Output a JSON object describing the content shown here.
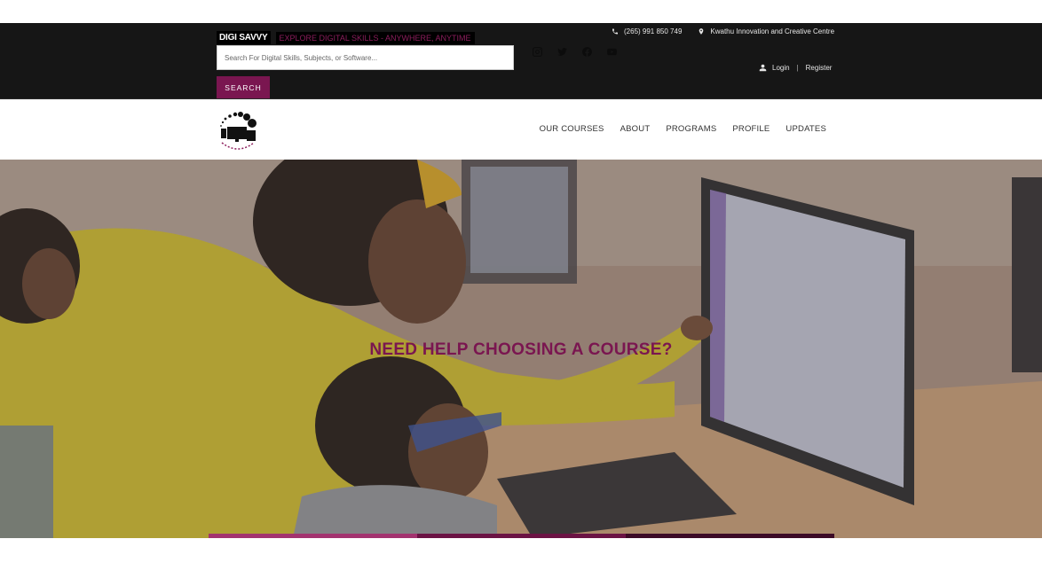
{
  "topbar": {
    "brand_name": "DIGI SAVVY",
    "tagline": "EXPLORE DIGITAL SKILLS - ANYWHERE, ANYTIME",
    "search_placeholder": "Search For Digital Skills, Subjects, or Software...",
    "search_button": "SEARCH",
    "phone": "(265) 991 850 749",
    "location": "Kwathu Innovation and Creative Centre",
    "login": "Login",
    "separator": "|",
    "register": "Register",
    "social_icons": [
      "instagram-icon",
      "twitter-icon",
      "facebook-icon",
      "youtube-icon"
    ]
  },
  "nav": {
    "items": [
      {
        "label": "OUR COURSES"
      },
      {
        "label": "ABOUT"
      },
      {
        "label": "PROGRAMS"
      },
      {
        "label": "PROFILE"
      },
      {
        "label": "UPDATES"
      }
    ]
  },
  "hero": {
    "title": "NEED HELP CHOOSING A COURSE?"
  },
  "colors": {
    "brand": "#7a1650",
    "topbar": "#161616",
    "stripe_1": "#a3336f",
    "stripe_2": "#6b1344",
    "stripe_3": "#3c0a26"
  }
}
